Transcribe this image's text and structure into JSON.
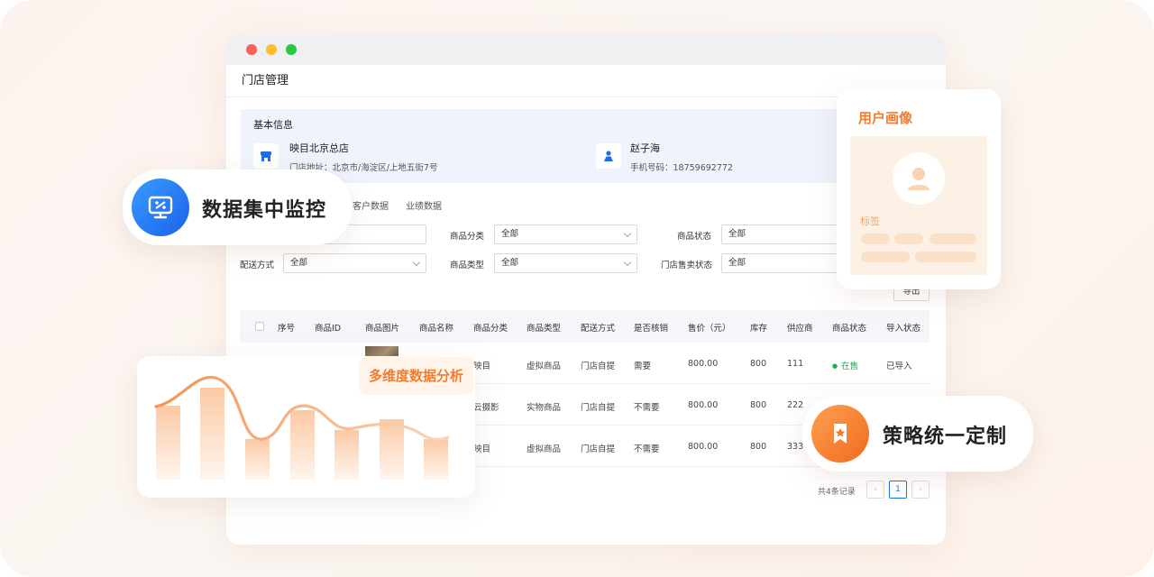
{
  "page": {
    "title": "门店管理"
  },
  "basic_info": {
    "title": "基本信息",
    "store_name": "映目北京总店",
    "store_address": "门店地址：北京市/海淀区/上地五街7号",
    "person_name": "赵子海",
    "person_phone": "手机号码：18759692772"
  },
  "tabs": [
    "客户数据",
    "业绩数据"
  ],
  "filters": {
    "category_label": "商品分类",
    "category_value": "全部",
    "status_label": "商品状态",
    "status_value": "全部",
    "delivery_label": "配送方式",
    "delivery_value": "全部",
    "type_label": "商品类型",
    "type_value": "全部",
    "sale_status_label": "门店售卖状态",
    "sale_status_value": "全部"
  },
  "export_label": "导出",
  "table": {
    "headers": [
      "序号",
      "商品ID",
      "商品图片",
      "商品名称",
      "商品分类",
      "商品类型",
      "配送方式",
      "是否核销",
      "售价（元）",
      "库存",
      "供应商",
      "商品状态",
      "导入状态"
    ],
    "rows": [
      {
        "category": "映目",
        "type": "虚拟商品",
        "delivery": "门店自提",
        "verify": "需要",
        "price": "800.00",
        "stock": "800",
        "supplier": "111",
        "status": "在售",
        "import": "已导入"
      },
      {
        "category": "云摄影",
        "type": "实物商品",
        "delivery": "门店自提",
        "verify": "不需要",
        "price": "800.00",
        "stock": "800",
        "supplier": "222"
      },
      {
        "category": "映目",
        "type": "虚拟商品",
        "delivery": "门店自提",
        "verify": "不需要",
        "price": "800.00",
        "stock": "800",
        "supplier": "333"
      }
    ]
  },
  "pagination": {
    "total_text": "共4条记录",
    "current_page": "1",
    "prev": "‹",
    "next": "›"
  },
  "badges": {
    "monitor": "数据集中监控",
    "analysis": "多维度数据分析",
    "strategy": "策略统一定制"
  },
  "profile": {
    "title": "用户画像",
    "tag_label": "标签"
  },
  "colors": {
    "accent_orange": "#f07d2e",
    "accent_blue": "#1a6fe8",
    "status_green": "#1aaa55"
  }
}
